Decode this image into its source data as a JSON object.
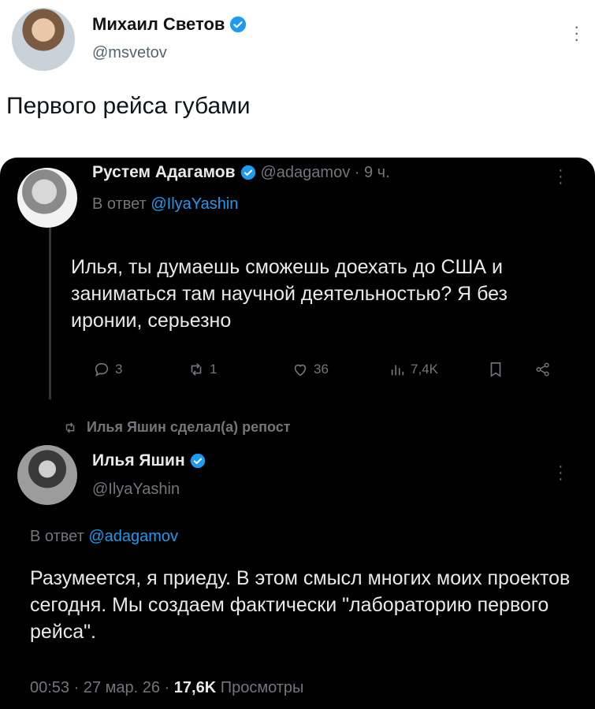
{
  "outer_tweet": {
    "author_name": "Михаил Светов",
    "author_handle": "@msvetov",
    "text": "Первого рейса губами"
  },
  "quoted_thread": {
    "reply_tweet": {
      "author_name": "Рустем Адагамов",
      "meta": "@adagamov · 9 ч.",
      "reply_prefix": "В ответ",
      "reply_to": "@IlyaYashin",
      "text": "Илья, ты думаешь сможешь доехать до США и заниматься там научной деятельностью? Я без иронии, серьезно",
      "actions": {
        "replies": "3",
        "reposts": "1",
        "likes": "36",
        "views": "7,4K"
      }
    },
    "repost_note": "Илья Яшин сделал(а) репост",
    "main_tweet": {
      "author_name": "Илья Яшин",
      "author_handle": "@IlyaYashin",
      "reply_prefix": "В ответ",
      "reply_to": "@adagamov",
      "text": "Разумеется, я приеду. В этом смысл многих моих проектов сегодня. Мы создаем фактически \"лабораторию первого рейса\".",
      "time_date": "00:53 · 27 мар. 26 ·",
      "views_count": "17,6K",
      "views_label": "Просмотры"
    }
  },
  "colors": {
    "accent": "#1d9bf0",
    "dark_bg": "#000000",
    "dark_text": "#e7e9ea",
    "muted": "#71767b"
  }
}
